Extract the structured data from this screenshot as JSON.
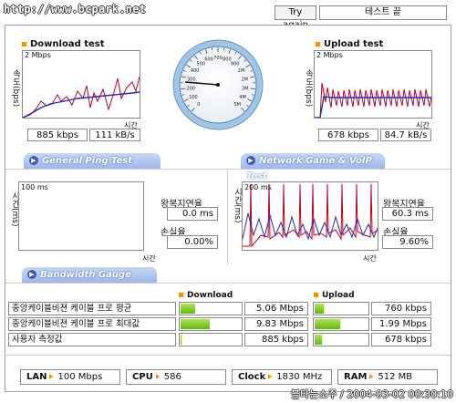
{
  "header": {
    "url": "http://www.bcpark.net",
    "try_again": "Try again",
    "test_end": "테스트 끝"
  },
  "download": {
    "title": "Download test",
    "y_axis": "속도(bps)",
    "scale": "2 Mbps",
    "x_axis": "시간",
    "kbps": "885 kbps",
    "kBs": "111 kB/s"
  },
  "upload": {
    "title": "Upload test",
    "y_axis": "속도(bps)",
    "scale": "2 Mbps",
    "x_axis": "시간",
    "kbps": "678 kbps",
    "kBs": "84.7 kB/s"
  },
  "gauge": {
    "ticks": [
      "0",
      "100",
      "200",
      "300",
      "400",
      "500",
      "600",
      "700",
      "800",
      "900",
      "1M",
      "2M",
      "3M",
      "4M",
      "5M"
    ],
    "reading_kbps": 885
  },
  "ping": {
    "tab": "General Ping Test",
    "y_axis": "시간(ms)",
    "scale": "100 ms",
    "x_axis": "시간",
    "latency_label": "왕복지연율",
    "latency_value": "0.0 ms",
    "loss_label": "손실율",
    "loss_value": "0.00%"
  },
  "game": {
    "tab": "Network Game & VoIP Test",
    "y_axis": "시간(ms)",
    "scale": "200 ms",
    "x_axis": "시간",
    "latency_label": "왕복지연율",
    "latency_value": "60.3 ms",
    "loss_label": "손실율",
    "loss_value": "9.60%"
  },
  "bandwidth": {
    "tab": "Bandwidth Gauge",
    "download_header": "Download",
    "upload_header": "Upload",
    "rows": [
      {
        "label": "중앙케이블비젼 케이블 프로 평균",
        "download": "5.06 Mbps",
        "download_fraction": 0.26,
        "upload": "760 kbps",
        "upload_fraction": 0.2
      },
      {
        "label": "중앙케이블비젼 케이블 프로 최대값",
        "download": "9.83 Mbps",
        "download_fraction": 0.5,
        "upload": "1.99 Mbps",
        "upload_fraction": 0.5
      },
      {
        "label": "사용자 측정값",
        "download": "885 kbps",
        "download_fraction": 0.05,
        "upload": "678 kbps",
        "upload_fraction": 0.17
      }
    ]
  },
  "system": {
    "lan_label": "LAN",
    "lan_value": "100 Mbps",
    "cpu_label": "CPU",
    "cpu_value": "586",
    "clock_label": "Clock",
    "clock_value": "1830 MHz",
    "ram_label": "RAM",
    "ram_value": "512 MB"
  },
  "watermark": "블타는소주 / 2004-03-02 00:30:10",
  "colors": {
    "accent_orange": "#f29200",
    "tab_blue": "#9db8ea",
    "bar_green": "#62b80c",
    "download_line": "#c0001e",
    "trend_line": "#2a2ab8"
  }
}
